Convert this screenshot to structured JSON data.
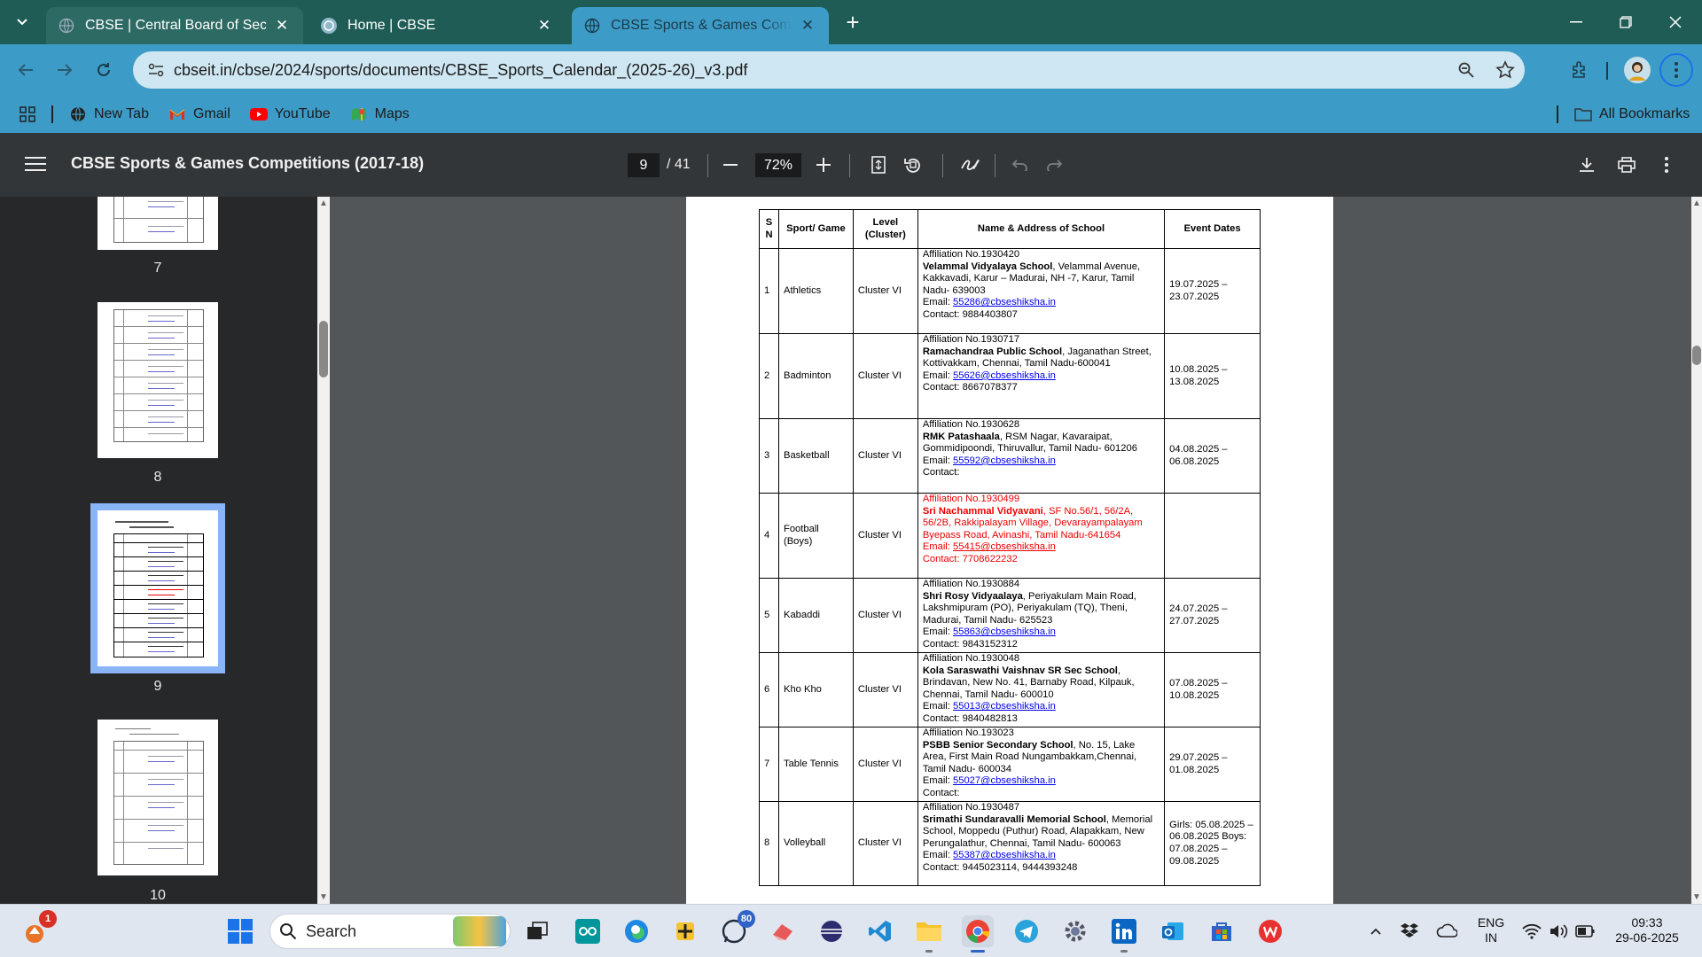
{
  "browser": {
    "tabs": [
      {
        "title": "CBSE | Central Board of Secondary Education",
        "state": "inactive"
      },
      {
        "title": "Home | CBSE",
        "state": "inactive"
      },
      {
        "title": "CBSE Sports & Games Competitions",
        "state": "active"
      }
    ],
    "new_tab_symbol": "+",
    "url": "cbseit.in/cbse/2024/sports/documents/CBSE_Sports_Calendar_(2025-26)_v3.pdf",
    "bookmarks": [
      {
        "label": "New Tab",
        "icon": "globe-icon"
      },
      {
        "label": "Gmail",
        "icon": "gmail-icon"
      },
      {
        "label": "YouTube",
        "icon": "youtube-icon"
      },
      {
        "label": "Maps",
        "icon": "maps-icon"
      }
    ],
    "all_bookmarks_label": "All Bookmarks",
    "accent": "#3d9cc7",
    "frame": "#1f5c55"
  },
  "pdf": {
    "title": "CBSE Sports & Games Competitions (2017-18)",
    "current_page": "9",
    "total_pages": "/ 41",
    "zoom": "72%",
    "thumbnails": [
      {
        "num": "7"
      },
      {
        "num": "8"
      },
      {
        "num": "9",
        "selected": true
      },
      {
        "num": "10"
      }
    ],
    "table": {
      "headers": {
        "sn": "S N",
        "game": "Sport/ Game",
        "level": "Level (Cluster)",
        "school": "Name & Address of School",
        "dates": "Event Dates"
      },
      "rows": [
        {
          "sn": "1",
          "game": "Athletics",
          "level": "Cluster VI",
          "affiliation": "Affiliation No.1930420",
          "school": "Velammal Vidyalaya School",
          "address": ", Velammal Avenue, Kakkavadi, Karur – Madurai, NH -7, Karur, Tamil Nadu- 639003",
          "email_label": "Email: ",
          "email": "55286@cbseshiksha.in",
          "contact": "Contact: 9884403807",
          "dates": "19.07.2025 – 23.07.2025",
          "highlight": false
        },
        {
          "sn": "2",
          "game": "Badminton",
          "level": "Cluster VI",
          "affiliation": "Affiliation No.1930717",
          "school": "Ramachandraa Public School",
          "address": ", Jaganathan Street, Kottivakkam, Chennai, Tamil Nadu-600041",
          "email_label": "Email: ",
          "email": "55626@cbseshiksha.in",
          "contact": "Contact: 8667078377",
          "dates": "10.08.2025 – 13.08.2025",
          "highlight": false
        },
        {
          "sn": "3",
          "game": "Basketball",
          "level": "Cluster VI",
          "affiliation": "Affiliation No.1930628",
          "school": "RMK Patashaala",
          "address": ", RSM Nagar, Kavaraipat, Gommidipoondi, Thiruvallur, Tamil Nadu- 601206",
          "email_label": "Email: ",
          "email": "55592@cbseshiksha.in",
          "contact": "Contact:",
          "dates": "04.08.2025 – 06.08.2025",
          "highlight": false
        },
        {
          "sn": "4",
          "game": "Football (Boys)",
          "level": "Cluster VI",
          "affiliation": "Affiliation No.1930499",
          "school": "Sri Nachammal Vidyavani",
          "address": ", SF No.56/1, 56/2A, 56/2B, Rakkipalayam Village, Devarayampalayam Byepass Road, Avinashi, Tamil Nadu-641654",
          "email_label": "Email: ",
          "email": "55415@cbseshiksha.in",
          "contact": "Contact: 7708622232",
          "dates": "",
          "highlight": true
        },
        {
          "sn": "5",
          "game": "Kabaddi",
          "level": "Cluster VI",
          "affiliation": "Affiliation No.1930884",
          "school": "Shri Rosy Vidyaalaya",
          "address": ", Periyakulam Main Road, Lakshmipuram (PO), Periyakulam (TQ), Theni, Madurai, Tamil Nadu- 625523",
          "email_label": "Email: ",
          "email": "55863@cbseshiksha.in",
          "contact": "Contact: 9843152312",
          "dates": "24.07.2025 – 27.07.2025",
          "highlight": false
        },
        {
          "sn": "6",
          "game": "Kho Kho",
          "level": "Cluster VI",
          "affiliation": "Affiliation No.1930048",
          "school": "Kola Saraswathi Vaishnav SR Sec School",
          "address": ", Brindavan, New No. 41, Barnaby Road, Kilpauk, Chennai, Tamil Nadu- 600010",
          "email_label": "Email: ",
          "email": "55013@cbseshiksha.in",
          "contact": "Contact: 9840482813",
          "dates": "07.08.2025 – 10.08.2025",
          "highlight": false
        },
        {
          "sn": "7",
          "game": "Table Tennis",
          "level": "Cluster VI",
          "affiliation": "Affiliation No.193023",
          "school": "PSBB Senior Secondary School",
          "address": ", No. 15, Lake Area, First Main Road Nungambakkam,Chennai, Tamil Nadu- 600034",
          "email_label": "Email: ",
          "email": "55027@cbseshiksha.in",
          "contact": "Contact:",
          "dates": "29.07.2025 – 01.08.2025",
          "highlight": false
        },
        {
          "sn": "8",
          "game": "Volleyball",
          "level": "Cluster VI",
          "affiliation": "Affiliation No.1930487",
          "school": "Srimathi Sundaravalli Memorial School",
          "address": ", Memorial School, Moppedu (Puthur) Road, Alapakkam, New Perungalathur, Chennai, Tamil Nadu- 600063",
          "email_label": "Email: ",
          "email": "55387@cbseshiksha.in",
          "contact": "Contact: 9445023114, 9444393248",
          "dates": "Girls: 05.08.2025 – 06.08.2025 Boys: 07.08.2025 – 09.08.2025",
          "highlight": false
        }
      ]
    }
  },
  "taskbar": {
    "search_label": "Search",
    "notification_badge": "1",
    "whatsapp_badge": "80",
    "language_line1": "ENG",
    "language_line2": "IN",
    "time": "09:33",
    "date": "29-06-2025"
  }
}
